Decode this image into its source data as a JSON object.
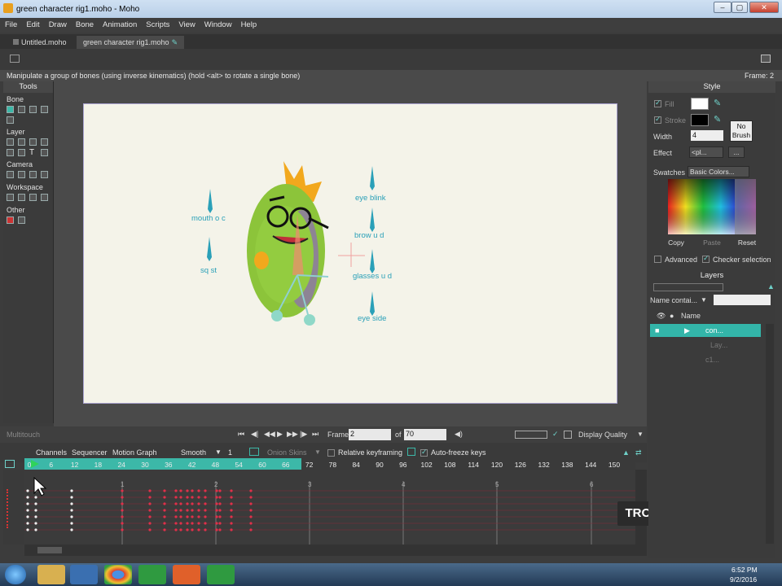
{
  "window": {
    "title": "green character rig1.moho - Moho",
    "min": "–",
    "max": "▢",
    "close": "✕"
  },
  "menu": [
    "File",
    "Edit",
    "Draw",
    "Bone",
    "Animation",
    "Scripts",
    "View",
    "Window",
    "Help"
  ],
  "doc_tabs": [
    {
      "label": "Untitled.moho"
    },
    {
      "label": "green character rig1.moho"
    }
  ],
  "status": {
    "message": "Manipulate a group of bones (using inverse kinematics) (hold <alt> to rotate a single bone)",
    "frame": "Frame: 2"
  },
  "tools": {
    "title": "Tools",
    "sections": [
      "Bone",
      "Layer",
      "Camera",
      "Workspace",
      "Other"
    ]
  },
  "canvas": {
    "labels": [
      "mouth o c",
      "sq st",
      "eye blink",
      "brow u d",
      "glasses u d",
      "eye side"
    ]
  },
  "playbar": {
    "multitouch": "Multitouch",
    "frame_label": "Frame",
    "frame_value": "2",
    "of_label": "of",
    "of_value": "70",
    "display_quality": "Display Quality"
  },
  "timeline": {
    "tabs": [
      "Channels",
      "Sequencer",
      "Motion Graph"
    ],
    "interp": "Smooth",
    "interp_num": "1",
    "onion": "Onion Skins",
    "relative": "Relative keyframing",
    "autofreeze": "Auto-freeze keys",
    "ruler": [
      "0",
      "6",
      "12",
      "18",
      "24",
      "30",
      "36",
      "42",
      "48",
      "54",
      "60",
      "66",
      "72",
      "78",
      "84",
      "90",
      "96",
      "102",
      "108",
      "114",
      "120",
      "126",
      "132",
      "138",
      "144",
      "150"
    ],
    "markers": [
      "1",
      "2",
      "3",
      "4",
      "5",
      "6"
    ]
  },
  "style": {
    "title": "Style",
    "fill": "Fill",
    "stroke": "Stroke",
    "width_label": "Width",
    "width_value": "4",
    "no_brush": "No Brush",
    "effect": "Effect",
    "effect_value": "<pl...",
    "swatches": "Swatches",
    "swatch_set": "Basic Colors...",
    "copy": "Copy",
    "paste": "Paste",
    "reset": "Reset",
    "advanced": "Advanced",
    "checker": "Checker selection",
    "fill_color": "#ffffff",
    "stroke_color": "#000000"
  },
  "layers": {
    "title": "Layers",
    "filter": "Name contai...",
    "name_col": "Name",
    "rows": [
      {
        "name": "con..."
      },
      {
        "name": "Lay..."
      },
      {
        "name": "c1..."
      }
    ]
  },
  "watermark": "TROY PICOU",
  "clock": {
    "time": "6:52 PM",
    "date": "9/2/2016"
  },
  "colors": {
    "accent": "#3cb8a8",
    "label": "#2aa0b8",
    "key": "#e0304a"
  }
}
